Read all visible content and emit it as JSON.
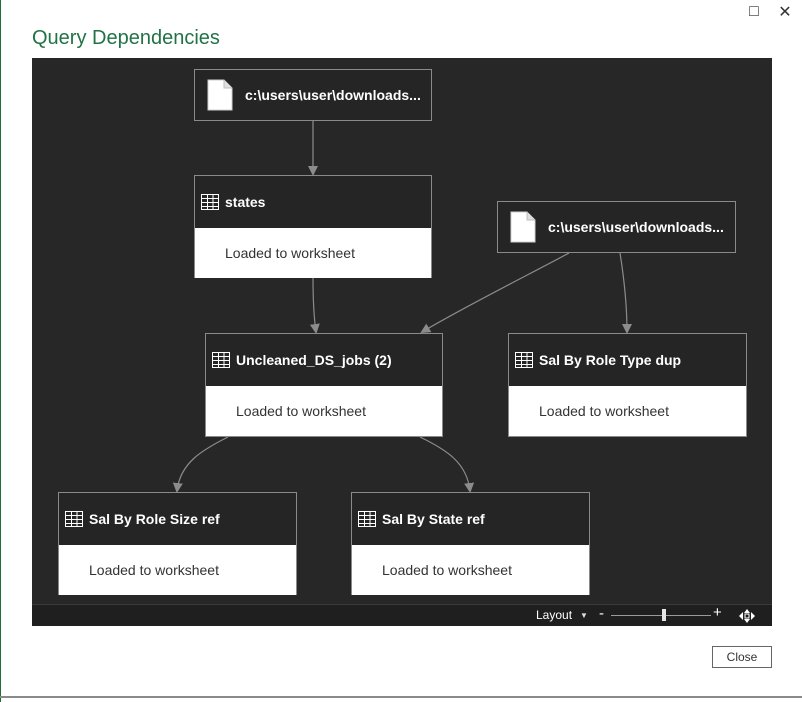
{
  "window": {
    "title": "Query Dependencies",
    "maximize_icon": "□",
    "close_icon": "✕"
  },
  "nodes": {
    "source_1": {
      "label": "c:\\users\\user\\downloads...",
      "icon": "file-icon"
    },
    "source_2": {
      "label": "c:\\users\\user\\downloads...",
      "icon": "file-icon"
    },
    "states": {
      "label": "states",
      "status": "Loaded to worksheet",
      "icon": "table-icon"
    },
    "uncleaned": {
      "label": "Uncleaned_DS_jobs (2)",
      "status": "Loaded to worksheet",
      "icon": "table-icon"
    },
    "role_type": {
      "label": "Sal By Role Type dup",
      "status": "Loaded to worksheet",
      "icon": "table-icon"
    },
    "role_size": {
      "label": "Sal By Role Size ref",
      "status": "Loaded to worksheet",
      "icon": "table-icon"
    },
    "state_ref": {
      "label": "Sal By State ref",
      "status": "Loaded to worksheet",
      "icon": "table-icon"
    }
  },
  "edges": [
    {
      "from": "source_1",
      "to": "states"
    },
    {
      "from": "states",
      "to": "uncleaned"
    },
    {
      "from": "source_2",
      "to": "uncleaned"
    },
    {
      "from": "source_2",
      "to": "role_type"
    },
    {
      "from": "uncleaned",
      "to": "role_size"
    },
    {
      "from": "uncleaned",
      "to": "state_ref"
    }
  ],
  "statusbar": {
    "layout_label": "Layout",
    "zoom_minus": "-",
    "zoom_plus": "+",
    "zoom_level": 0.53
  },
  "footer": {
    "close_label": "Close"
  },
  "colors": {
    "canvas": "#272727",
    "title": "#217346",
    "node_border": "#8a8a8a",
    "edge": "#8c8c8c"
  }
}
